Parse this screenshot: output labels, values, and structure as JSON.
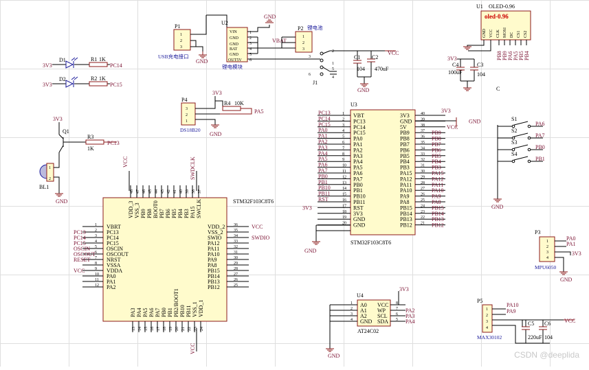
{
  "watermark": "CSDN @deeplida",
  "power": {
    "v33": "3V3",
    "vcc": "VCC",
    "gnd": "GND"
  },
  "p1": {
    "ref": "P1",
    "name": "USB充电接口",
    "pins": [
      "1",
      "2",
      "3"
    ]
  },
  "u2": {
    "ref": "U2",
    "name": "锂电模块",
    "pins": [
      "VIN",
      "GND",
      "GND",
      "BAT",
      "GND",
      "OUT5V"
    ],
    "nums": [
      "1",
      "2",
      "3",
      "4",
      "5",
      "6"
    ],
    "net_vbat": "VBAT"
  },
  "p2": {
    "ref": "P2",
    "name": "锂电池",
    "pins": [
      "1",
      "2",
      "3"
    ]
  },
  "j1": {
    "ref": "J1",
    "nums": [
      "1",
      "2",
      "3",
      "4",
      "5",
      "6"
    ]
  },
  "caps": {
    "c1": "C1",
    "c2": "C2",
    "c1v": "104",
    "c2v": "470uF",
    "c3": "C3",
    "c4": "C4",
    "c4v": "100uF",
    "c3v": "104",
    "c5": "C5",
    "c6": "C6",
    "c5v": "220uF",
    "c6v": "104",
    "c": "C"
  },
  "oled": {
    "ref": "U1",
    "name": "OLED-0.96",
    "chip": "oled-0.96",
    "pins": [
      "GND",
      "VCC",
      "CLK",
      "MOSI",
      "DC",
      "CS1",
      "CS2"
    ],
    "nets": [
      "PB8",
      "PB9",
      "PA6",
      "PA5",
      "PB5",
      "PB4"
    ]
  },
  "leds": [
    {
      "ref": "D1",
      "r": "R1",
      "val": "1K",
      "net": "PC14"
    },
    {
      "ref": "D2",
      "r": "R2",
      "val": "1K",
      "net": "PC15"
    }
  ],
  "p4": {
    "ref": "P4",
    "name": "DS18B20",
    "pins": [
      "3",
      "2",
      "1"
    ],
    "r": "R4",
    "rv": "10K",
    "net": "PA5"
  },
  "q1": {
    "ref": "Q1",
    "r": "R3",
    "rv": "1K",
    "net": "PC13",
    "bz": "BL1",
    "bzpins": [
      "1",
      "2"
    ]
  },
  "mcu": {
    "name": "STM32F103C8T6",
    "left": [
      [
        "1",
        "VBRT",
        ""
      ],
      [
        "2",
        "PC13",
        "PC13"
      ],
      [
        "3",
        "PC14",
        "PC14"
      ],
      [
        "4",
        "PC15",
        "PC15"
      ],
      [
        "5",
        "OSCIN",
        "OSCIN"
      ],
      [
        "6",
        "OSCOUT",
        "OSCOUT"
      ],
      [
        "7",
        "NRST",
        "RESET"
      ],
      [
        "8",
        "VSSA",
        ""
      ],
      [
        "9",
        "VDDA",
        "VCC"
      ],
      [
        "10",
        "PA0",
        ""
      ],
      [
        "11",
        "PA1",
        ""
      ],
      [
        "12",
        "PA2",
        ""
      ]
    ],
    "right": [
      [
        "36",
        "VDD_2",
        "VCC"
      ],
      [
        "35",
        "VSS_2",
        ""
      ],
      [
        "34",
        "SWIO",
        "SWDIO"
      ],
      [
        "33",
        "PA12",
        ""
      ],
      [
        "32",
        "PA11",
        ""
      ],
      [
        "31",
        "PA10",
        ""
      ],
      [
        "30",
        "PA9",
        ""
      ],
      [
        "29",
        "PA8",
        ""
      ],
      [
        "28",
        "PB15",
        ""
      ],
      [
        "27",
        "PB14",
        ""
      ],
      [
        "26",
        "PB13",
        ""
      ],
      [
        "25",
        "PB12",
        ""
      ]
    ],
    "top": [
      [
        "48",
        "VDD_3"
      ],
      [
        "47",
        "VSS_3"
      ],
      [
        "46",
        "PB9"
      ],
      [
        "45",
        "PB8"
      ],
      [
        "44",
        "BOOT0"
      ],
      [
        "43",
        "PB7"
      ],
      [
        "42",
        "PB6"
      ],
      [
        "41",
        "PB5"
      ],
      [
        "40",
        "PB4"
      ],
      [
        "39",
        "PB3"
      ],
      [
        "38",
        "PA15"
      ],
      [
        "37",
        "SWCLK"
      ]
    ],
    "bottom": [
      [
        "13",
        "PA3"
      ],
      [
        "14",
        "PA4"
      ],
      [
        "15",
        "PA5"
      ],
      [
        "16",
        "PA6"
      ],
      [
        "17",
        "PA7"
      ],
      [
        "18",
        "PB0"
      ],
      [
        "19",
        "PB1"
      ],
      [
        "20",
        "PB2/BOOT1"
      ],
      [
        "21",
        "PB10"
      ],
      [
        "22",
        "PB11"
      ],
      [
        "23",
        "VSS_1"
      ],
      [
        "24",
        "VDD_1"
      ]
    ],
    "top_nets": {
      "vcc": "VCC",
      "swdclk": "SWDCLK"
    },
    "bottom_net": "VCC"
  },
  "u3": {
    "ref": "U3",
    "name": "STM32F103C8T6",
    "left": [
      [
        "1",
        "VBT",
        "PC13"
      ],
      [
        "2",
        "PC13",
        "PC14"
      ],
      [
        "3",
        "PC14",
        "PC15"
      ],
      [
        "4",
        "PC15",
        "PA0"
      ],
      [
        "5",
        "PA0",
        "PA1"
      ],
      [
        "6",
        "PA1",
        "PA2"
      ],
      [
        "7",
        "PA2",
        "PA3"
      ],
      [
        "8",
        "PA3",
        "PA4"
      ],
      [
        "9",
        "PA4",
        "PA5"
      ],
      [
        "10",
        "PA5",
        "PA6"
      ],
      [
        "11",
        "PA6",
        "PA7"
      ],
      [
        "12",
        "PA7",
        "PB0"
      ],
      [
        "13",
        "PB0",
        "PB1"
      ],
      [
        "14",
        "PB1",
        "PB10"
      ],
      [
        "15",
        "PB10",
        "PB11"
      ],
      [
        "16",
        "PB11",
        "RST"
      ],
      [
        "17",
        "RST",
        "3V3"
      ],
      [
        "18",
        "3V3",
        ""
      ],
      [
        "19",
        "GND",
        ""
      ],
      [
        "20",
        "GND",
        ""
      ]
    ],
    "right": [
      [
        "40",
        "3V3",
        "3V3"
      ],
      [
        "39",
        "GND",
        "GND"
      ],
      [
        "38",
        "5V",
        "VCC"
      ],
      [
        "37",
        "PB9",
        "PB9"
      ],
      [
        "36",
        "PB8",
        "PB8"
      ],
      [
        "35",
        "PB7",
        "PB7"
      ],
      [
        "34",
        "PB6",
        "PB6"
      ],
      [
        "33",
        "PB5",
        "PB5"
      ],
      [
        "32",
        "PB4",
        "PB4"
      ],
      [
        "31",
        "PB3",
        "PB3"
      ],
      [
        "30",
        "PA15",
        "PA15"
      ],
      [
        "29",
        "PA12",
        "PA12"
      ],
      [
        "28",
        "PA11",
        "PA11"
      ],
      [
        "27",
        "PA10",
        "PA10"
      ],
      [
        "26",
        "PA9",
        "PA9"
      ],
      [
        "25",
        "PA8",
        "PA8"
      ],
      [
        "24",
        "PB15",
        "PB15"
      ],
      [
        "23",
        "PB14",
        "PB14"
      ],
      [
        "22",
        "PB13",
        "PB13"
      ],
      [
        "21",
        "PB12",
        "PB12"
      ]
    ]
  },
  "keys": [
    {
      "ref": "S1",
      "net": "PA6"
    },
    {
      "ref": "S2",
      "net": "PA7"
    },
    {
      "ref": "S3",
      "net": "PB0"
    },
    {
      "ref": "S4",
      "net": "PB1"
    }
  ],
  "p3": {
    "ref": "P3",
    "name": "MPU6050",
    "pins": [
      "1",
      "2",
      "3",
      "4"
    ],
    "nets": [
      "PA0",
      "PA1",
      "3V3"
    ]
  },
  "u4": {
    "ref": "U4",
    "name": "AT24C02",
    "left": [
      [
        "1",
        "A0"
      ],
      [
        "2",
        "A1"
      ],
      [
        "3",
        "A2"
      ],
      [
        "4",
        "GND"
      ]
    ],
    "right": [
      [
        "8",
        "VCC",
        "3V3"
      ],
      [
        "7",
        "WP",
        "PA2"
      ],
      [
        "6",
        "SCL",
        "PA3"
      ],
      [
        "5",
        "SDA",
        "PA4"
      ]
    ]
  },
  "p5": {
    "ref": "P5",
    "name": "MAX30102",
    "pins": [
      "1",
      "2",
      "3",
      "4"
    ],
    "nets": [
      "PA10",
      "PA9"
    ]
  }
}
